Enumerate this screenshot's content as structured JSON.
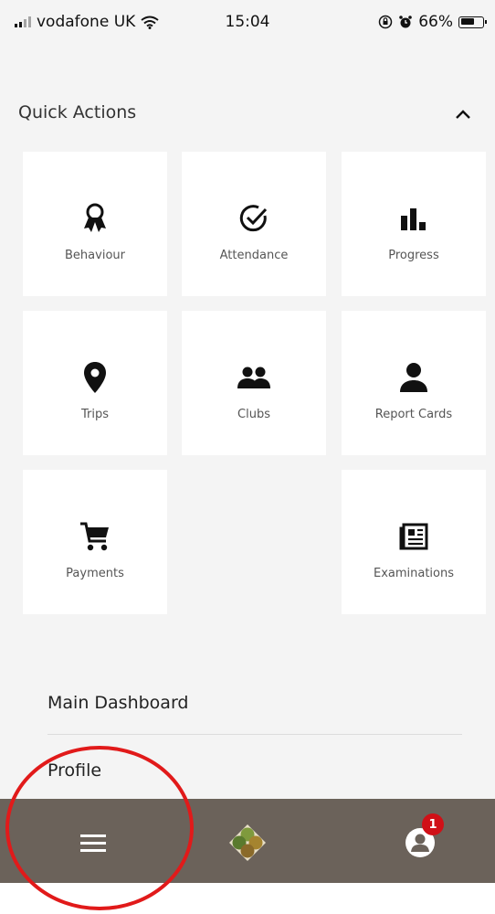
{
  "status_bar": {
    "carrier": "vodafone UK",
    "time": "15:04",
    "battery": "66%",
    "battery_level": 0.66
  },
  "quick_actions": {
    "title": "Quick Actions",
    "collapse_icon": "chevron-up-icon",
    "tiles": [
      {
        "label": "Behaviour",
        "icon": "award-ribbon-icon"
      },
      {
        "label": "Attendance",
        "icon": "check-circle-icon"
      },
      {
        "label": "Progress",
        "icon": "bar-chart-icon"
      },
      {
        "label": "Trips",
        "icon": "map-pin-icon"
      },
      {
        "label": "Clubs",
        "icon": "group-icon"
      },
      {
        "label": "Report Cards",
        "icon": "person-icon"
      },
      {
        "label": "Payments",
        "icon": "cart-icon"
      },
      {
        "label": "Examinations",
        "icon": "newspaper-icon"
      }
    ]
  },
  "menu": {
    "items": [
      "Main Dashboard",
      "Profile"
    ]
  },
  "bottom_nav": {
    "menu_icon": "hamburger-menu-icon",
    "logo_icon": "school-logo-icon",
    "account_icon": "account-icon",
    "notification_count": "1"
  },
  "colors": {
    "background": "#f4f4f4",
    "tile": "#ffffff",
    "bottom_bar": "#6b625a",
    "badge": "#d01017",
    "annotation_ring": "#e11a1a"
  }
}
